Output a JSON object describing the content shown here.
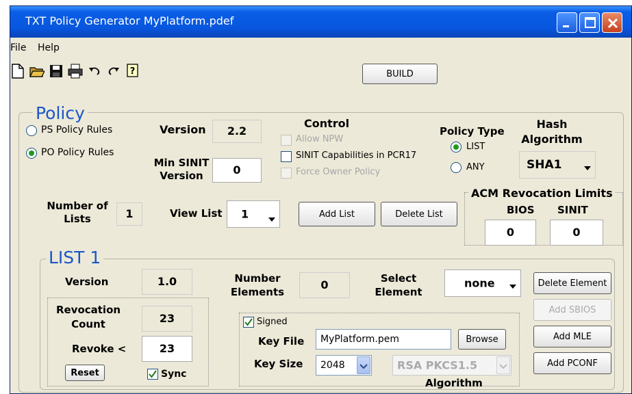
{
  "window": {
    "title": "TXT Policy Generator   MyPlatform.pdef"
  },
  "menu": {
    "items": [
      "File",
      "Help"
    ]
  },
  "toolbar": {
    "icons": [
      "new-file-icon",
      "open-folder-icon",
      "save-icon",
      "print-icon",
      "undo-icon",
      "redo-icon",
      "help-icon"
    ],
    "build_label": "BUILD"
  },
  "policy": {
    "title": "Policy",
    "rules": [
      {
        "label": "PS Policy Rules",
        "selected": false
      },
      {
        "label": "PO Policy Rules",
        "selected": true
      }
    ],
    "version_label": "Version",
    "version_value": "2.2",
    "min_sinit_label": "Min SINIT\nVersion",
    "min_sinit_value": "0",
    "control": {
      "title": "Control",
      "options": [
        {
          "label": "Allow NPW",
          "checked": false,
          "enabled": false
        },
        {
          "label": "SINIT Capabilities in PCR17",
          "checked": false,
          "enabled": true
        },
        {
          "label": "Force Owner Policy",
          "checked": false,
          "enabled": false
        }
      ]
    },
    "policy_type": {
      "title": "Policy Type",
      "options": [
        {
          "label": "LIST",
          "selected": true
        },
        {
          "label": "ANY",
          "selected": false
        }
      ]
    },
    "hash": {
      "title": "Hash\nAlgorithm",
      "value": "SHA1"
    },
    "num_lists_label": "Number of\nLists",
    "num_lists_value": "1",
    "view_list_label": "View List",
    "view_list_value": "1",
    "add_list_label": "Add List",
    "delete_list_label": "Delete List",
    "acm": {
      "title": "ACM Revocation Limits",
      "bios_label": "BIOS",
      "bios_value": "0",
      "sinit_label": "SINIT",
      "sinit_value": "0"
    }
  },
  "list": {
    "title": "LIST 1",
    "version_label": "Version",
    "version_value": "1.0",
    "revocation_count_label": "Revocation\nCount",
    "revocation_count_value": "23",
    "revoke_label": "Revoke <",
    "revoke_value": "23",
    "reset_label": "Reset",
    "sync_label": "Sync",
    "sync_checked": true,
    "number_elements_label": "Number\nElements",
    "number_elements_value": "0",
    "select_element_label": "Select\nElement",
    "select_element_value": "none",
    "buttons": {
      "delete_element": "Delete Element",
      "add_sbios": "Add SBIOS",
      "add_mle": "Add MLE",
      "add_pconf": "Add PCONF"
    },
    "signed": {
      "label": "Signed",
      "checked": true,
      "key_file_label": "Key File",
      "key_file_value": "MyPlatform.pem",
      "browse_label": "Browse",
      "key_size_label": "Key Size",
      "key_size_value": "2048",
      "algorithm_value": "RSA PKCS1.5",
      "algorithm_label": "Algorithm"
    }
  }
}
